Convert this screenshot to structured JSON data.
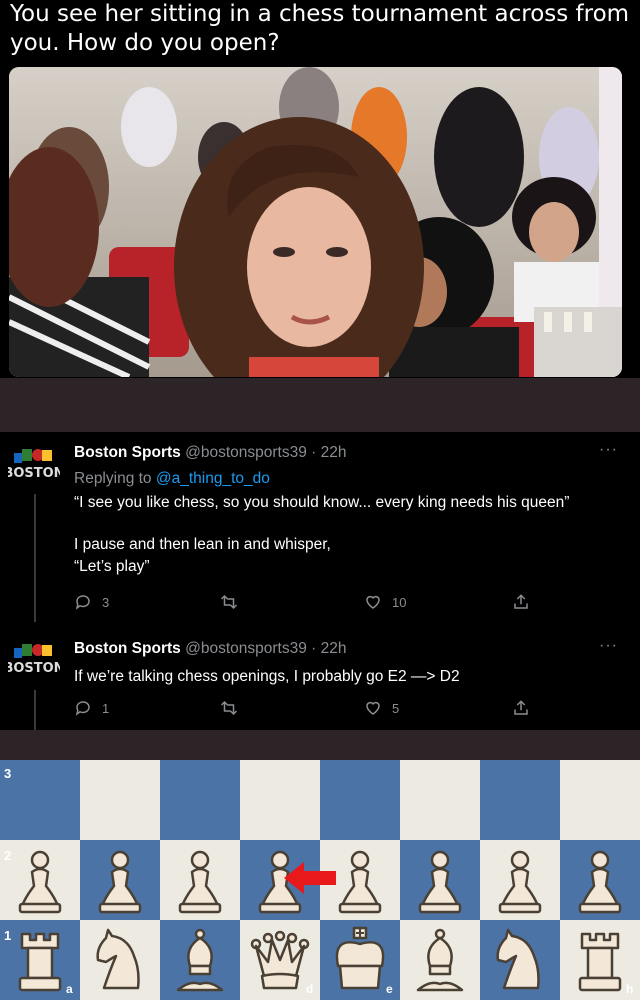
{
  "caption": {
    "text": "You see her sitting in a chess tournament across from you. How do you open?"
  },
  "tweets": [
    {
      "author_name": "Boston Sports",
      "author_handle": "@bostonsports39",
      "separator": "·",
      "time": "22h",
      "avatar_text": "BOSTON",
      "more": "···",
      "replying_prefix": "Replying to",
      "replying_to": "@a_thing_to_do",
      "body_lines": [
        "“I see you like chess, so you should know... every king needs his queen”",
        "I pause and then lean in and whisper,",
        "“Let’s play”"
      ],
      "replies": "3",
      "retweets": "",
      "likes": "10"
    },
    {
      "author_name": "Boston Sports",
      "author_handle": "@bostonsports39",
      "separator": "·",
      "time": "22h",
      "avatar_text": "BOSTON",
      "more": "···",
      "body_lines": [
        "If we’re talking chess openings, I probably go E2 —> D2"
      ],
      "replies": "1",
      "retweets": "",
      "likes": "5"
    }
  ],
  "board": {
    "rank_labels": [
      "3",
      "2",
      "1"
    ],
    "file_labels": [
      "a",
      "d",
      "e",
      "h"
    ],
    "colors": {
      "light": "#edeae2",
      "dark": "#4b73a5",
      "arrow": "#e8191b"
    },
    "rank2_pieces": [
      "pawn",
      "pawn",
      "pawn",
      "pawn",
      "pawn",
      "pawn",
      "pawn",
      "pawn"
    ],
    "rank1_pieces": [
      "rook",
      "knight",
      "bishop",
      "queen",
      "king",
      "bishop",
      "knight",
      "rook"
    ]
  }
}
